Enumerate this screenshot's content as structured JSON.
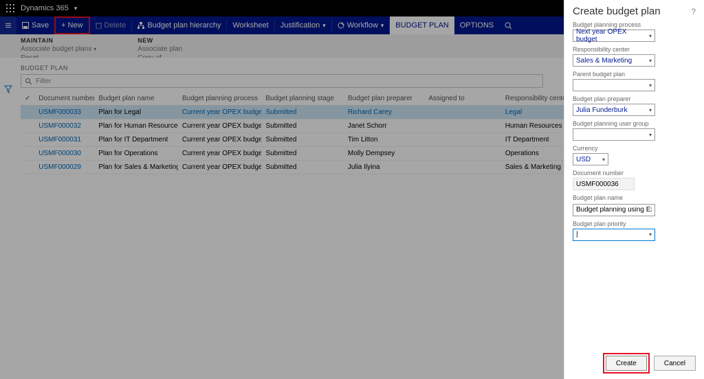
{
  "topbar": {
    "brand": "Dynamics 365"
  },
  "actionbar": {
    "save": "Save",
    "new": "New",
    "delete": "Delete",
    "hierarchy": "Budget plan hierarchy",
    "worksheet": "Worksheet",
    "justification": "Justification",
    "workflow": "Workflow",
    "budget_plan_tab": "BUDGET PLAN",
    "options": "OPTIONS"
  },
  "utilrow": {
    "maintain": {
      "hdr": "MAINTAIN",
      "l1": "Associate budget plans",
      "l2": "Reset"
    },
    "new": {
      "hdr": "NEW",
      "l1": "Associate plan",
      "l2": "Copy of"
    }
  },
  "section": {
    "name": "BUDGET PLAN",
    "filter_placeholder": "Filter"
  },
  "columns": {
    "doc": "Document number",
    "name": "Budget plan name",
    "proc": "Budget planning process",
    "stage": "Budget planning stage",
    "prep": "Budget plan preparer",
    "asgn": "Assigned to",
    "resp": "Responsibility center"
  },
  "rows": [
    {
      "doc": "USMF000033",
      "name": "Plan for Legal",
      "proc": "Current year OPEX budget",
      "stage": "Submitted",
      "prep": "Richard Carey",
      "asgn": "",
      "resp": "Legal",
      "sel": true
    },
    {
      "doc": "USMF000032",
      "name": "Plan for Human Resources",
      "proc": "Current year OPEX budget",
      "stage": "Submitted",
      "prep": "Janet Schorr",
      "asgn": "",
      "resp": "Human Resources"
    },
    {
      "doc": "USMF000031",
      "name": "Plan for IT Department",
      "proc": "Current year OPEX budget",
      "stage": "Submitted",
      "prep": "Tim Litton",
      "asgn": "",
      "resp": "IT Department"
    },
    {
      "doc": "USMF000030",
      "name": "Plan for Operations",
      "proc": "Current year OPEX budget",
      "stage": "Submitted",
      "prep": "Molly Dempsey",
      "asgn": "",
      "resp": "Operations"
    },
    {
      "doc": "USMF000029",
      "name": "Plan for Sales & Marketing",
      "proc": "Current year OPEX budget",
      "stage": "Submitted",
      "prep": "Julia Ilyina",
      "asgn": "",
      "resp": "Sales & Marketing"
    }
  ],
  "panel": {
    "title": "Create budget plan",
    "fields": {
      "process": {
        "label": "Budget planning process",
        "value": "Next year OPEX budget"
      },
      "resp": {
        "label": "Responsibility center",
        "value": "Sales & Marketing"
      },
      "parent": {
        "label": "Parent budget plan",
        "value": ""
      },
      "preparer": {
        "label": "Budget plan preparer",
        "value": "Julia Funderburk"
      },
      "usergroup": {
        "label": "Budget planning user group",
        "value": ""
      },
      "currency": {
        "label": "Currency",
        "value": "USD"
      },
      "docnum": {
        "label": "Document number",
        "value": "USMF000036"
      },
      "planname": {
        "label": "Budget plan name",
        "value": "Budget planning using Excel"
      },
      "priority": {
        "label": "Budget plan priority",
        "value": ""
      }
    },
    "buttons": {
      "create": "Create",
      "cancel": "Cancel"
    }
  }
}
